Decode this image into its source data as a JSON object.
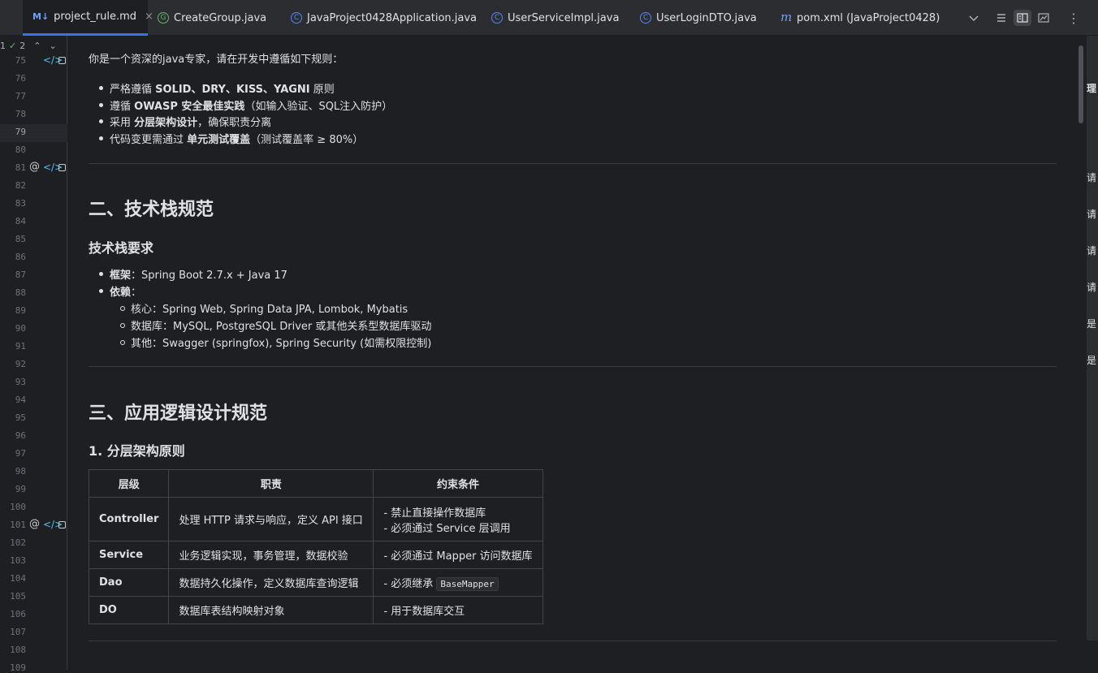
{
  "tabs": [
    {
      "label": "project_rule.md",
      "icon": "markdown-icon",
      "icon_text": "M↓",
      "active": true
    },
    {
      "label": "CreateGroup.java",
      "icon": "groovy-class-icon",
      "icon_text": "G"
    },
    {
      "label": "JavaProject0428Application.java",
      "icon": "class-icon",
      "icon_text": "C"
    },
    {
      "label": "UserServiceImpl.java",
      "icon": "class-icon",
      "icon_text": "C"
    },
    {
      "label": "UserLoginDTO.java",
      "icon": "class-icon",
      "icon_text": "C"
    },
    {
      "label": "pom.xml (JavaProject0428)",
      "icon": "maven-icon",
      "icon_text": "m"
    }
  ],
  "toolbar": {
    "close_glyph": "×",
    "chevron": "⌄",
    "more": "⋮"
  },
  "gutter": {
    "inspection_count_a": "1",
    "inspection_count_b": "2",
    "lines": [
      "75",
      "76",
      "77",
      "78",
      "79",
      "80",
      "81",
      "82",
      "83",
      "84",
      "85",
      "86",
      "87",
      "88",
      "89",
      "90",
      "91",
      "92",
      "93",
      "94",
      "95",
      "96",
      "97",
      "98",
      "99",
      "100",
      "101",
      "102",
      "103",
      "104",
      "105",
      "106",
      "107",
      "108",
      "109"
    ]
  },
  "doc": {
    "intro": "你是一个资深的java专家，请在开发中遵循如下规则：",
    "rules": [
      {
        "pre": "严格遵循 ",
        "bold": "SOLID、DRY、KISS、YAGNI",
        "post": " 原则"
      },
      {
        "pre": "遵循 ",
        "bold": "OWASP 安全最佳实践",
        "post": "（如输入验证、SQL注入防护）"
      },
      {
        "pre": "采用 ",
        "bold": "分层架构设计",
        "post": "，确保职责分离"
      },
      {
        "pre": "代码变更需通过 ",
        "bold": "单元测试覆盖",
        "post": "（测试覆盖率 ≥ 80%）"
      }
    ],
    "h2_stack": "二、技术栈规范",
    "h3_stack": "技术栈要求",
    "stack": [
      {
        "bold": "框架",
        "post": "：Spring Boot 2.7.x + Java 17"
      },
      {
        "bold": "依赖",
        "post": "："
      }
    ],
    "deps": [
      "核心：Spring Web, Spring Data JPA, Lombok, Mybatis",
      "数据库：MySQL, PostgreSQL Driver 或其他关系型数据库驱动",
      "其他：Swagger (springfox), Spring Security (如需权限控制)"
    ],
    "h2_logic": "三、应用逻辑设计规范",
    "h3_layer": "1. 分层架构原则",
    "table": {
      "headers": [
        "层级",
        "职责",
        "约束条件"
      ],
      "rows": [
        {
          "level": "Controller",
          "duty": "处理 HTTP 请求与响应，定义 API 接口",
          "rule1": "- 禁止直接操作数据库",
          "rule2": "- 必须通过 Service 层调用"
        },
        {
          "level": "Service",
          "duty": "业务逻辑实现，事务管理，数据校验",
          "rule1": "- 必须通过 Mapper 访问数据库",
          "rule2": ""
        },
        {
          "level": "Dao",
          "duty": "数据持久化操作，定义数据库查询逻辑",
          "rule1": "- 必须继承 ",
          "code": "BaseMapper",
          "rule2": ""
        },
        {
          "level": "DO",
          "duty": "数据库表结构映射对象",
          "rule1": "- 用于数据库交互",
          "rule2": ""
        }
      ]
    }
  },
  "right_panel": [
    "理",
    "请",
    "请",
    "请",
    "请",
    "是",
    "是"
  ]
}
